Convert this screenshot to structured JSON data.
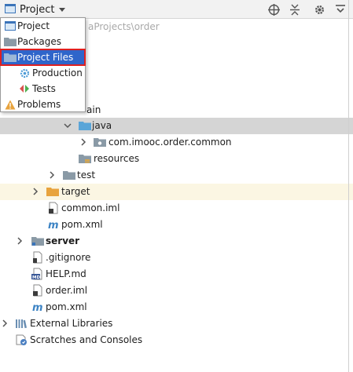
{
  "toolbar": {
    "view_label": "Project",
    "icons": [
      "project-view-icon",
      "dropdown-arrow-icon",
      "target-icon",
      "collapse-all-icon",
      "gear-icon",
      "hide-icon"
    ]
  },
  "popup": {
    "items": [
      {
        "label": "Project",
        "icon": "project-view-icon"
      },
      {
        "label": "Packages",
        "icon": "folder-icon"
      },
      {
        "label": "Project Files",
        "icon": "folder-icon",
        "selected": true
      },
      {
        "label": "Production",
        "icon": "production-icon"
      },
      {
        "label": "Tests",
        "icon": "tests-icon"
      },
      {
        "label": "Problems",
        "icon": "warning-icon"
      }
    ]
  },
  "tree": {
    "partial_path": "aProjects\\order",
    "partial_main": "ain",
    "items": [
      {
        "label": "java"
      },
      {
        "label": "com.imooc.order.common"
      },
      {
        "label": "resources"
      },
      {
        "label": "test"
      },
      {
        "label": "target"
      },
      {
        "label": "common.iml"
      },
      {
        "label": "pom.xml"
      },
      {
        "label": "server"
      },
      {
        "label": ".gitignore"
      },
      {
        "label": "HELP.md"
      },
      {
        "label": "order.iml"
      },
      {
        "label": "pom.xml"
      },
      {
        "label": "External Libraries"
      },
      {
        "label": "Scratches and Consoles"
      }
    ]
  },
  "colors": {
    "selection_blue": "#2f65ca",
    "highlight_red": "#e02020",
    "folder_blue": "#5aa5d8",
    "folder_grey": "#8a9aa6",
    "target_orange": "#e8a33d"
  }
}
